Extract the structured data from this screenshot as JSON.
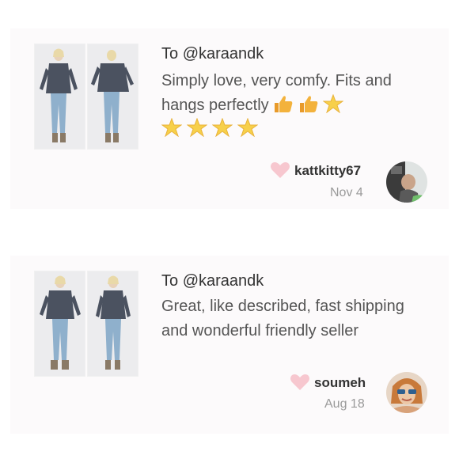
{
  "reviews": [
    {
      "to_prefix": "To",
      "to_handle": "@karaandk",
      "text": "Simply love, very comfy. Fits and hangs perfectly",
      "emojis": [
        "thumbs-up",
        "thumbs-up",
        "star",
        "star",
        "star",
        "star",
        "star"
      ],
      "username": "kattkitty67",
      "date": "Nov 4"
    },
    {
      "to_prefix": "To",
      "to_handle": "@karaandk",
      "text": "Great, like described, fast shipping and wonderful friendly seller",
      "username": "soumeh",
      "date": "Aug 18"
    }
  ],
  "colors": {
    "heart": "#f7c7cf",
    "card_bg": "#fcfafb",
    "star": "#f5c842",
    "thumb": "#f0b23a"
  }
}
